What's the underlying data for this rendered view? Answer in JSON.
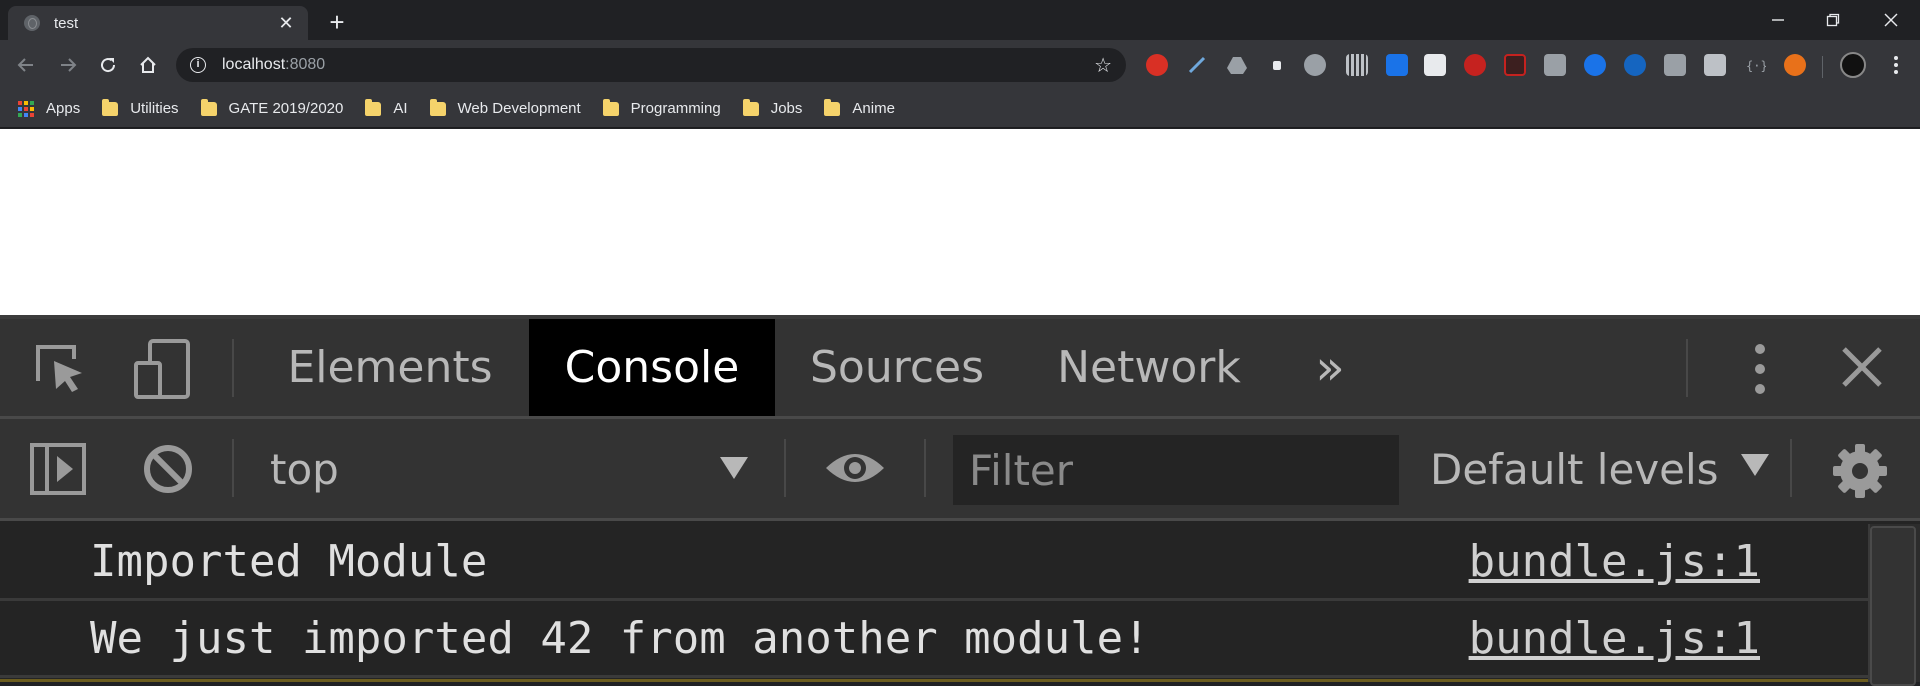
{
  "tab": {
    "title": "test",
    "close": "✕"
  },
  "window": {
    "new_tab": "+",
    "minimize": "—",
    "restore": "❐",
    "close": "✕"
  },
  "omnibox": {
    "host": "localhost",
    "port": ":8080"
  },
  "bookmarks": [
    {
      "label": "Apps",
      "icon": "apps-grid-icon"
    },
    {
      "label": "Utilities",
      "icon": "folder-icon"
    },
    {
      "label": "GATE 2019/2020",
      "icon": "folder-icon"
    },
    {
      "label": "AI",
      "icon": "folder-icon"
    },
    {
      "label": "Web Development",
      "icon": "folder-icon"
    },
    {
      "label": "Programming",
      "icon": "folder-icon"
    },
    {
      "label": "Jobs",
      "icon": "folder-icon"
    },
    {
      "label": "Anime",
      "icon": "folder-icon"
    }
  ],
  "devtools": {
    "tabs": [
      {
        "label": "Elements",
        "active": false
      },
      {
        "label": "Console",
        "active": true
      },
      {
        "label": "Sources",
        "active": false
      },
      {
        "label": "Network",
        "active": false
      }
    ],
    "more_tabs": "»",
    "console": {
      "context": "top",
      "filter_placeholder": "Filter",
      "levels": "Default levels",
      "messages": [
        {
          "text": "Imported Module",
          "source": "bundle.js:1"
        },
        {
          "text": "We just imported 42 from another module!",
          "source": "bundle.js:1"
        }
      ]
    }
  }
}
